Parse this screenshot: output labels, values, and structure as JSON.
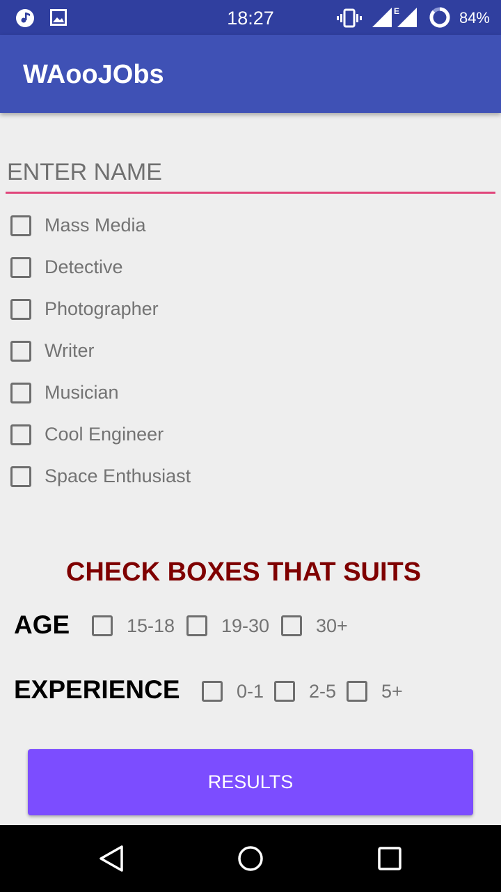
{
  "status_bar": {
    "time": "18:27",
    "battery": "84%",
    "network_label": "E",
    "icons": [
      "music-icon",
      "image-icon",
      "vibrate-icon",
      "signal-icon",
      "battery-icon"
    ]
  },
  "app_bar": {
    "title": "WAooJObs"
  },
  "name_field": {
    "placeholder": "ENTER NAME",
    "value": ""
  },
  "interests": [
    {
      "label": "Mass Media",
      "checked": false
    },
    {
      "label": "Detective",
      "checked": false
    },
    {
      "label": "Photographer",
      "checked": false
    },
    {
      "label": "Writer",
      "checked": false
    },
    {
      "label": "Musician",
      "checked": false
    },
    {
      "label": "Cool Engineer",
      "checked": false
    },
    {
      "label": "Space Enthusiast",
      "checked": false
    }
  ],
  "heading": "CHECK BOXES THAT SUITS",
  "age": {
    "label": "AGE",
    "options": [
      {
        "label": "15-18",
        "checked": false
      },
      {
        "label": "19-30",
        "checked": false
      },
      {
        "label": "30+",
        "checked": false
      }
    ]
  },
  "experience": {
    "label": "EXPERIENCE",
    "options": [
      {
        "label": "0-1",
        "checked": false
      },
      {
        "label": "2-5",
        "checked": false
      },
      {
        "label": "5+",
        "checked": false
      }
    ]
  },
  "results_button": {
    "label": "RESULTS"
  },
  "colors": {
    "status_bar": "#303f9f",
    "app_bar": "#3f51b5",
    "accent": "#e0457b",
    "heading": "#7f0000",
    "button": "#7c4dff"
  },
  "nav_bar": {
    "icons": [
      "back-icon",
      "home-icon",
      "recents-icon"
    ]
  }
}
